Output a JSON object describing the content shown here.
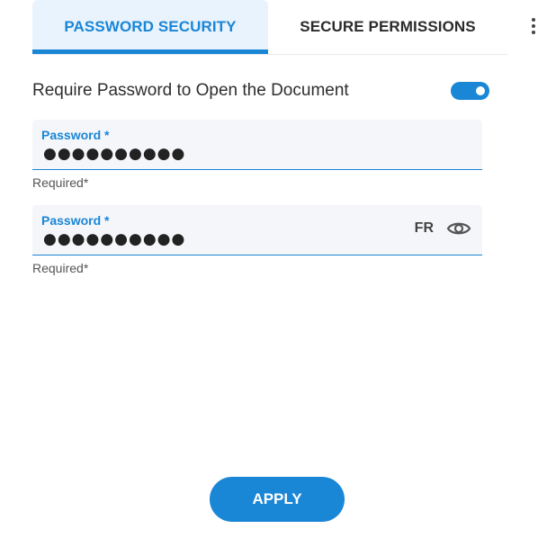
{
  "tabs": [
    {
      "label": "PASSWORD SECURITY",
      "active": true
    },
    {
      "label": "SECURE PERMISSIONS",
      "active": false
    }
  ],
  "require_password": {
    "label": "Require Password to Open the Document",
    "enabled": true
  },
  "fields": [
    {
      "label": "Password *",
      "value": "●●●●●●●●●●",
      "helper": "Required*"
    },
    {
      "label": "Password *",
      "value": "●●●●●●●●●●",
      "helper": "Required*",
      "lang_badge": "FR"
    }
  ],
  "icons": {
    "more": "more-vertical-icon",
    "eye": "eye-icon"
  },
  "colors": {
    "accent": "#1a86d6",
    "tab_active_bg": "#e8f3fd",
    "field_bg": "#f4f6f9"
  },
  "apply_label": "APPLY"
}
